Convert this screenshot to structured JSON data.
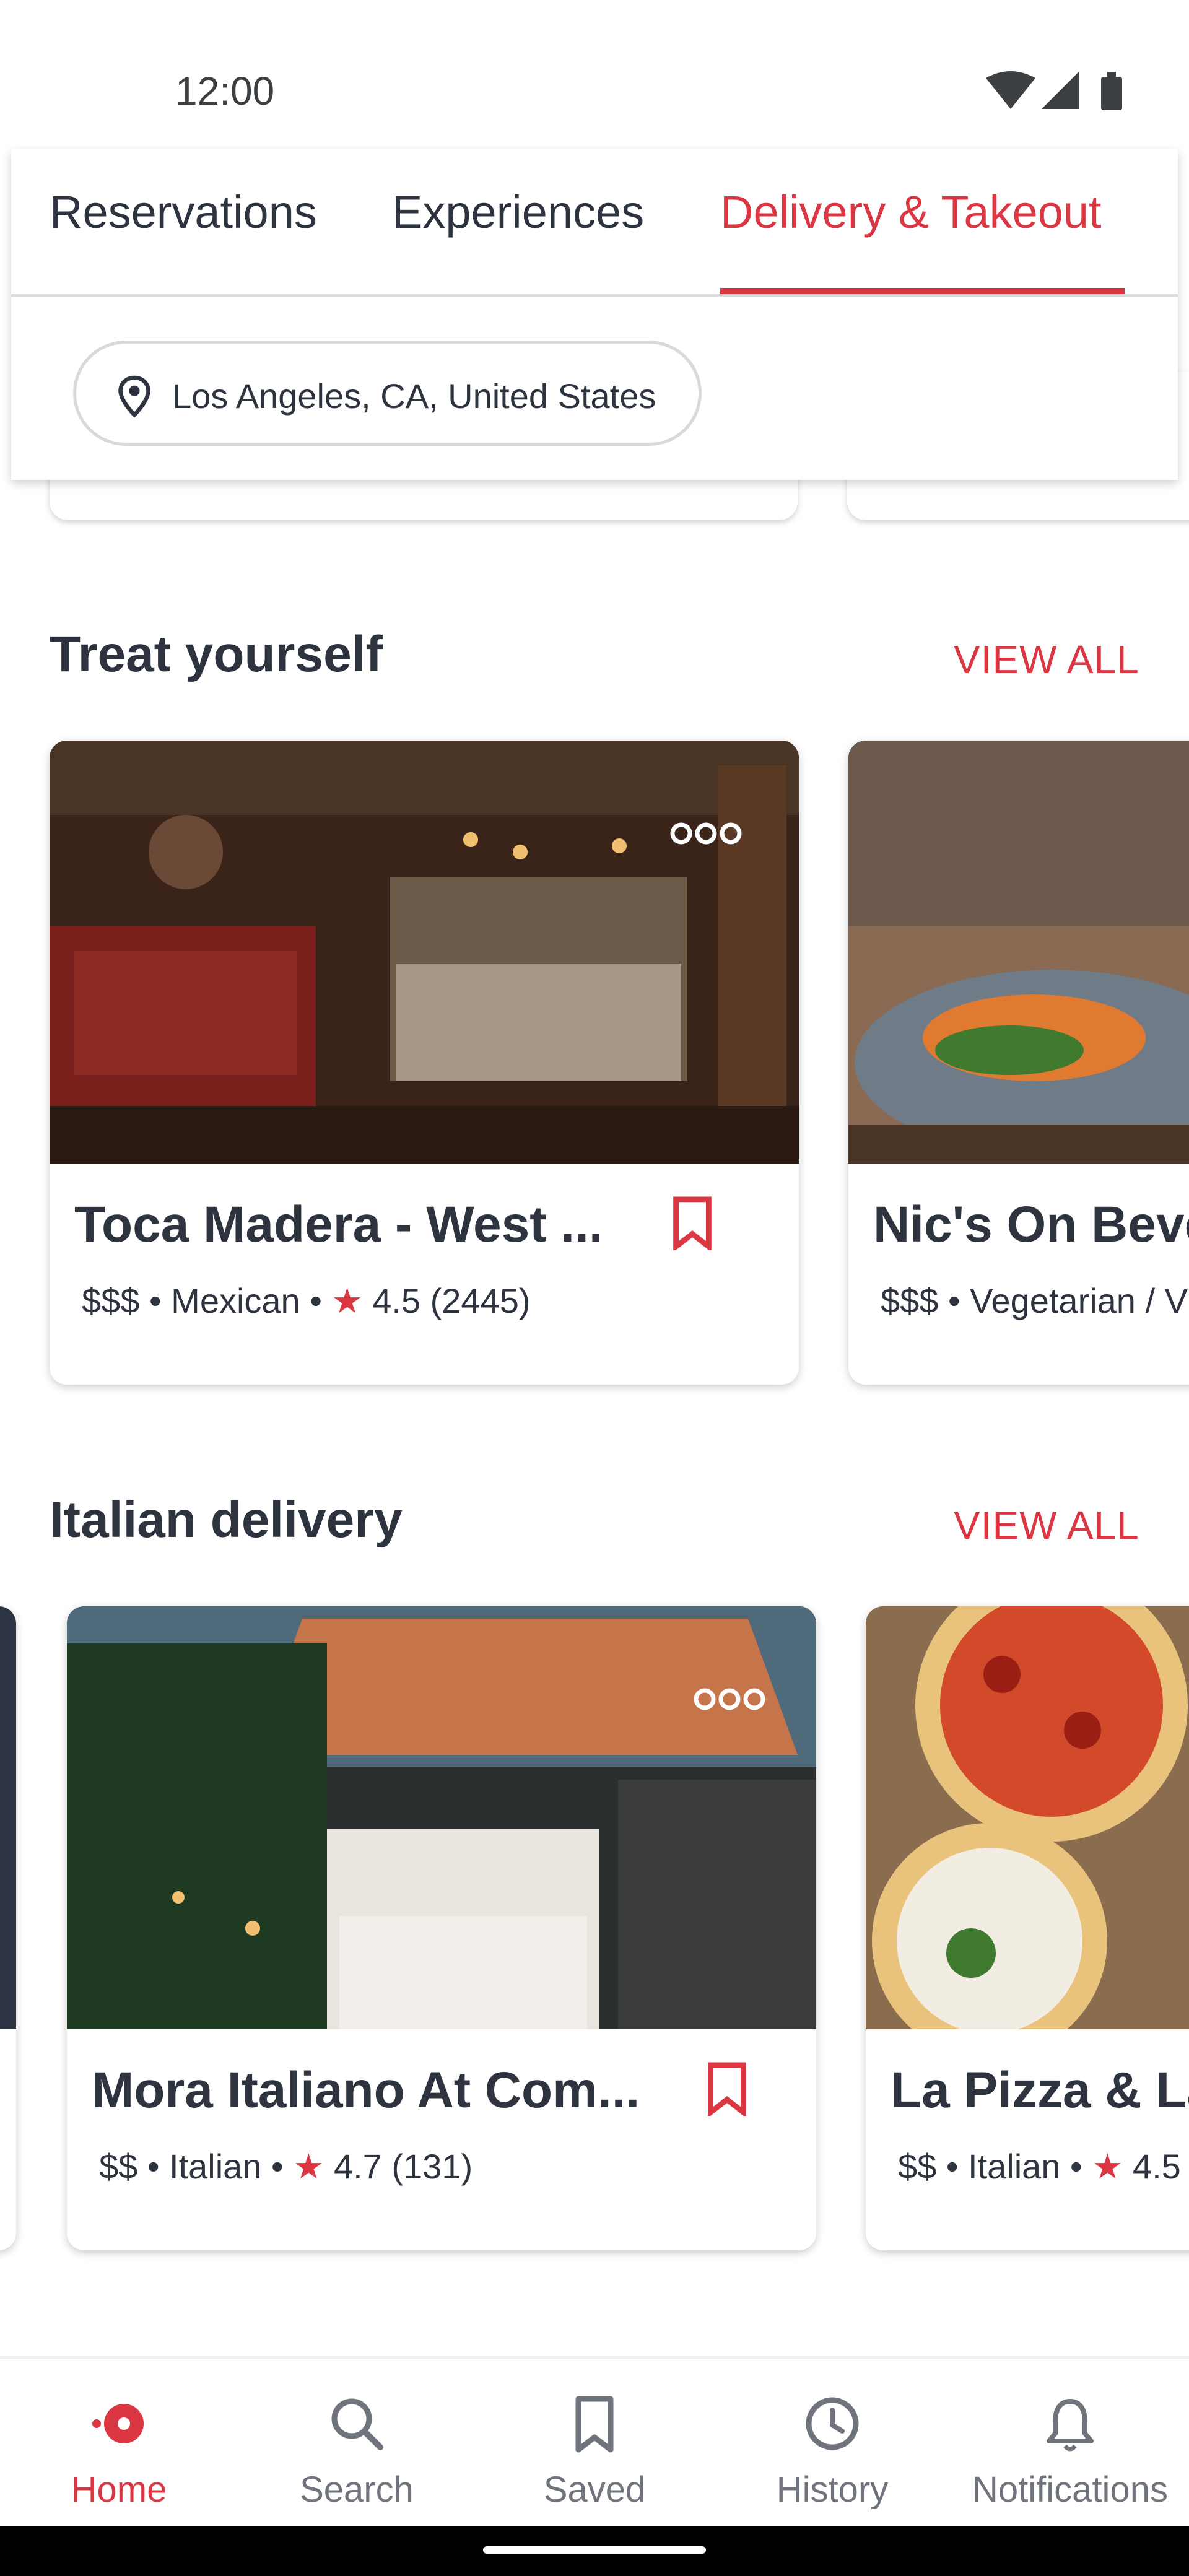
{
  "status_bar": {
    "time": "12:00",
    "icons": [
      "wifi-icon",
      "signal-icon",
      "battery-icon"
    ]
  },
  "tabs": [
    {
      "label": "Reservations",
      "selected": false
    },
    {
      "label": "Experiences",
      "selected": false
    },
    {
      "label": "Delivery & Takeout",
      "selected": true
    }
  ],
  "location": {
    "label": "Los Angeles, CA, United States",
    "icon": "location-pin-icon"
  },
  "sections": [
    {
      "title": "Treat yourself",
      "view_all": "VIEW ALL",
      "cards": [
        {
          "name": "Toca Madera - West ...",
          "price": "$$$",
          "cuisine": "Mexican",
          "rating": "4.5",
          "reviews": "(2445)"
        },
        {
          "name": "Nic's On Beve",
          "price": "$$$",
          "cuisine": "Vegetarian / V"
        }
      ]
    },
    {
      "title": "Italian delivery",
      "view_all": "VIEW ALL",
      "cards": [
        {
          "name": "Mora Italiano At Com...",
          "price": "$$",
          "cuisine": "Italian",
          "rating": "4.7",
          "reviews": "(131)"
        },
        {
          "name": "La Pizza & La",
          "price": "$$",
          "cuisine": "Italian",
          "rating": "4.5"
        }
      ]
    }
  ],
  "separator": "•",
  "star_glyph": "★",
  "bottom_nav": [
    {
      "label": "Home",
      "icon": "home-icon",
      "active": true
    },
    {
      "label": "Search",
      "icon": "search-icon",
      "active": false
    },
    {
      "label": "Saved",
      "icon": "bookmark-icon",
      "active": false
    },
    {
      "label": "History",
      "icon": "clock-icon",
      "active": false
    },
    {
      "label": "Notifications",
      "icon": "bell-icon",
      "active": false
    }
  ],
  "colors": {
    "brand": "#da3743",
    "text": "#2d333f",
    "muted": "#6f737b",
    "divider": "#d8d9db"
  }
}
